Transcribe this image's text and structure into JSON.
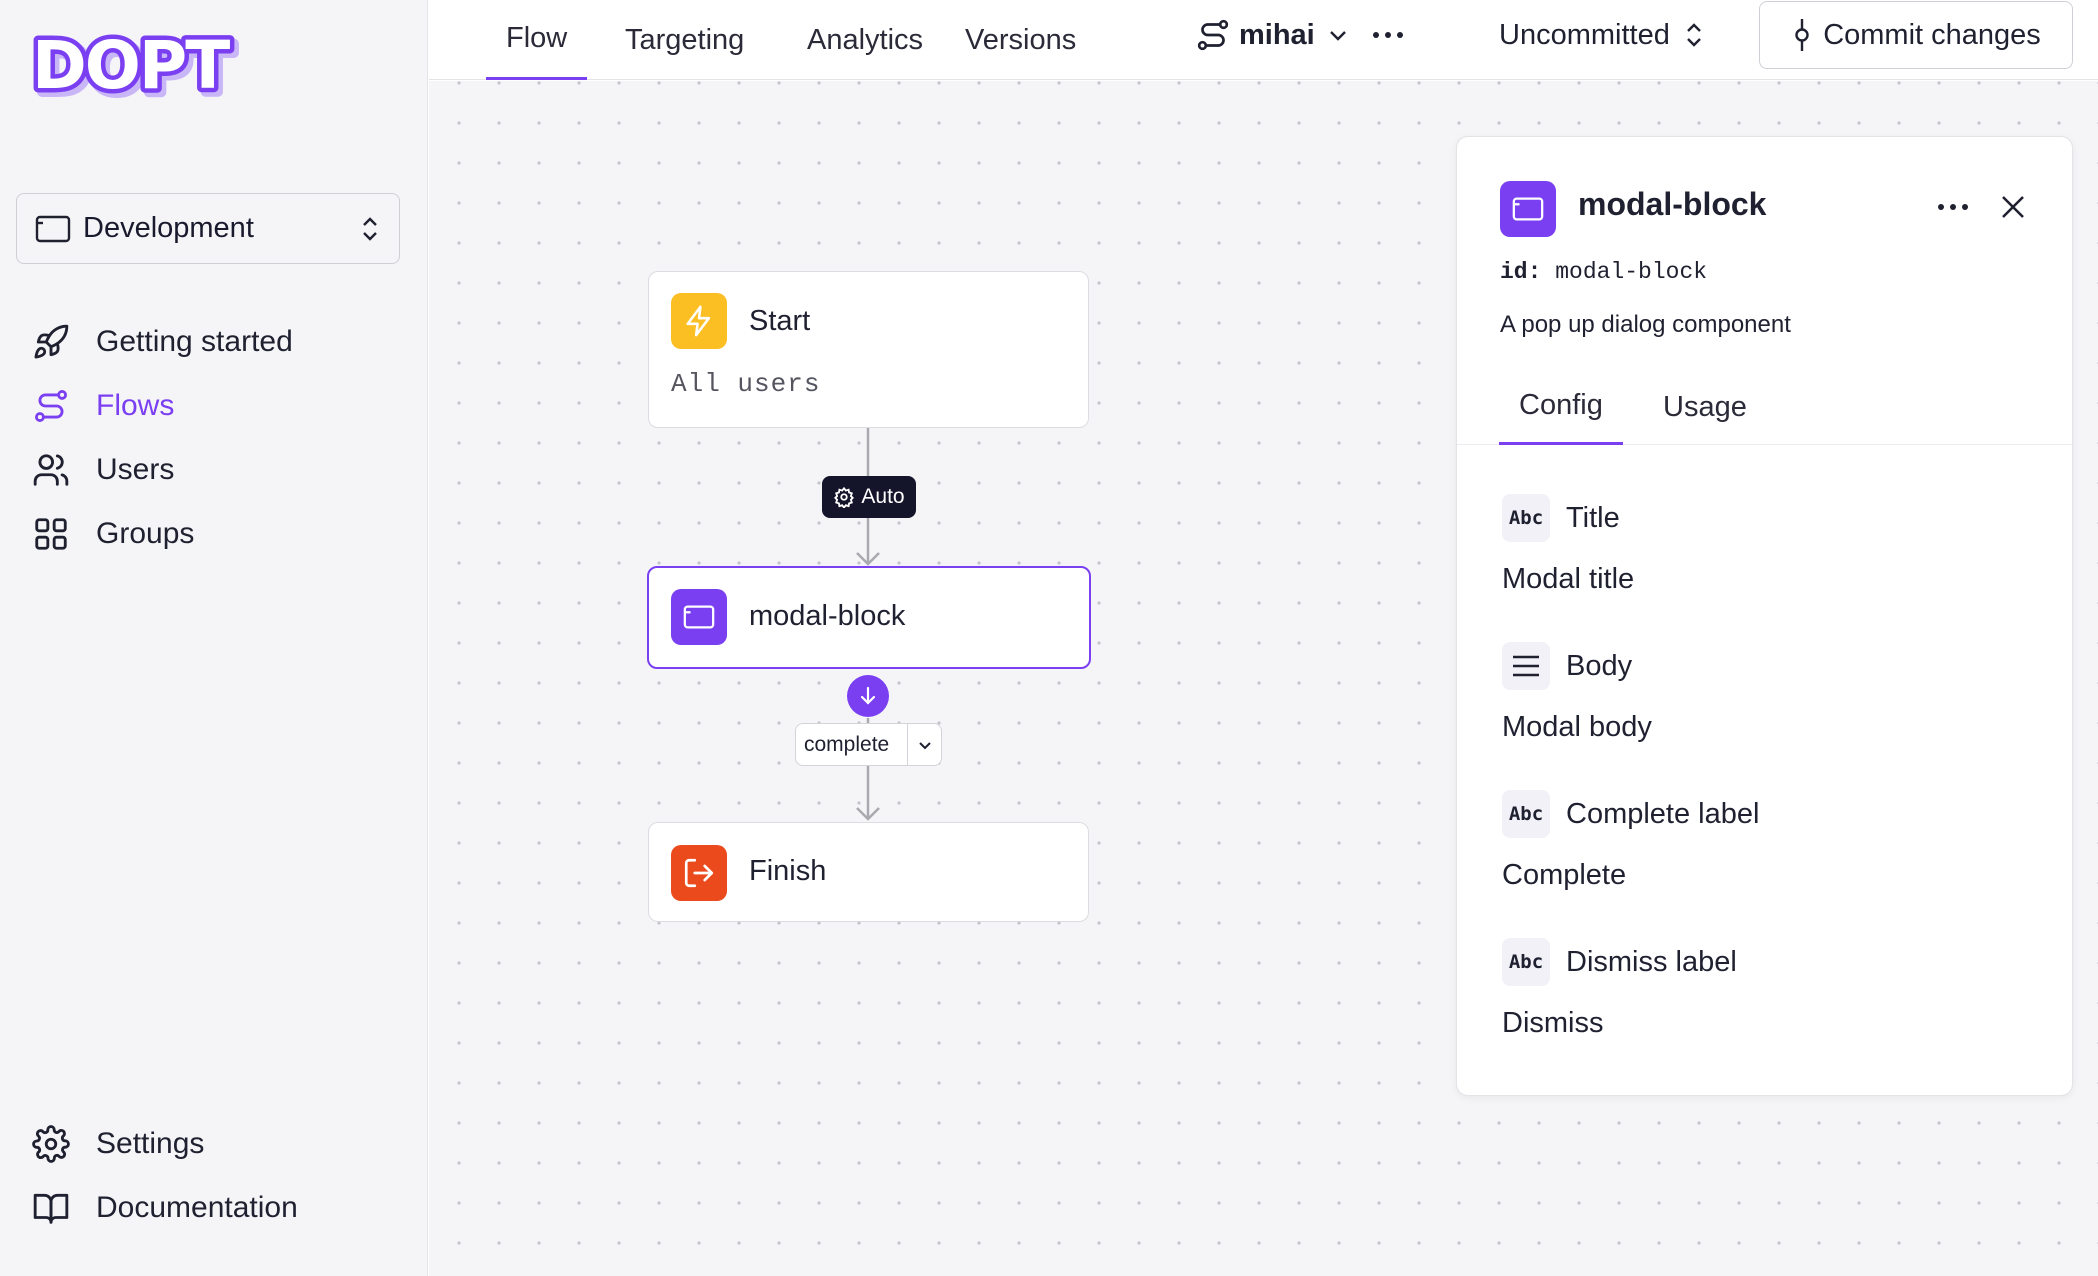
{
  "brand": {
    "logo_text": "DOPT",
    "accent": "#7b3ff2"
  },
  "sidebar": {
    "environment": "Development",
    "nav": [
      {
        "label": "Getting started",
        "icon": "rocket-icon",
        "active": false
      },
      {
        "label": "Flows",
        "icon": "flows-icon",
        "active": true
      },
      {
        "label": "Users",
        "icon": "users-icon",
        "active": false
      },
      {
        "label": "Groups",
        "icon": "grid-icon",
        "active": false
      }
    ],
    "bottom": [
      {
        "label": "Settings",
        "icon": "gear-icon"
      },
      {
        "label": "Documentation",
        "icon": "book-icon"
      }
    ]
  },
  "topbar": {
    "tabs": [
      "Flow",
      "Targeting",
      "Analytics",
      "Versions"
    ],
    "active_tab": "Flow",
    "branch": "mihai",
    "status": "Uncommitted",
    "commit_label": "Commit changes"
  },
  "flow": {
    "start": {
      "title": "Start",
      "subtitle": "All users"
    },
    "transition": "Auto",
    "block": {
      "title": "modal-block"
    },
    "edge_label": "complete",
    "finish": {
      "title": "Finish"
    }
  },
  "panel": {
    "title": "modal-block",
    "id_label": "id:",
    "id_value": "modal-block",
    "description": "A pop up dialog component",
    "tabs": [
      "Config",
      "Usage"
    ],
    "fields": [
      {
        "icon": "Abc",
        "name": "Title",
        "value": "Modal title"
      },
      {
        "icon": "lines",
        "name": "Body",
        "value": "Modal body"
      },
      {
        "icon": "Abc",
        "name": "Complete label",
        "value": "Complete"
      },
      {
        "icon": "Abc",
        "name": "Dismiss label",
        "value": "Dismiss"
      }
    ]
  }
}
